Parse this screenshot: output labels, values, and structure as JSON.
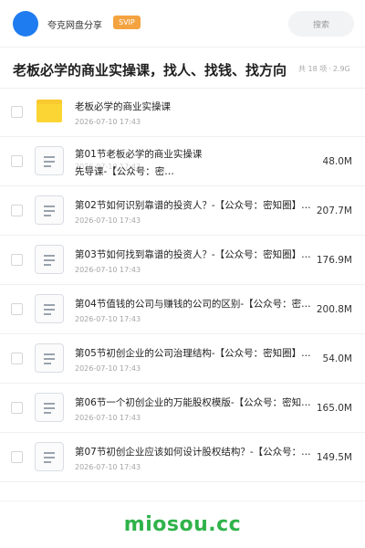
{
  "header": {
    "app_name": "夸克网盘分享",
    "badge": "SVIP",
    "search_placeholder": "搜索",
    "avatar_color": "#1f7cf0",
    "badge_color": "#f4a340"
  },
  "share": {
    "title": "老板必学的商业实操课，找人、找钱、找方向",
    "count_text": "共 18 项",
    "total_size": "2.9G"
  },
  "files": [
    {
      "icon": "folder-icon",
      "name": "老板必学的商业实操课",
      "date": "2026-07-10 17:43",
      "size": ""
    },
    {
      "icon": "document-icon",
      "name": "第01节老板必学的商业实操课",
      "subname": "先导课-【公众号：密…",
      "date": "2026-07-10 17:43",
      "size": "48.0M"
    },
    {
      "icon": "document-icon",
      "name": "第02节如何识别靠谱的投资人？-【公众号：密知圈】…",
      "date": "2026-07-10 17:43",
      "size": "207.7M"
    },
    {
      "icon": "document-icon",
      "name": "第03节如何找到靠谱的投资人？-【公众号：密知圈】…",
      "date": "2026-07-10 17:43",
      "size": "176.9M"
    },
    {
      "icon": "document-icon",
      "name": "第04节值钱的公司与赚钱的公司的区别-【公众号：密…",
      "date": "2026-07-10 17:43",
      "size": "200.8M"
    },
    {
      "icon": "document-icon",
      "name": "第05节初创企业的公司治理结构-【公众号：密知圈】…",
      "date": "2026-07-10 17:43",
      "size": "54.0M"
    },
    {
      "icon": "document-icon",
      "name": "第06节一个初创企业的万能股权模版-【公众号：密知…",
      "date": "2026-07-10 17:43",
      "size": "165.0M"
    },
    {
      "icon": "document-icon",
      "name": "第07节初创企业应该如何设计股权结构？-【公众号：…",
      "date": "2026-07-10 17:43",
      "size": "149.5M"
    }
  ],
  "watermark": "miosou.cc"
}
